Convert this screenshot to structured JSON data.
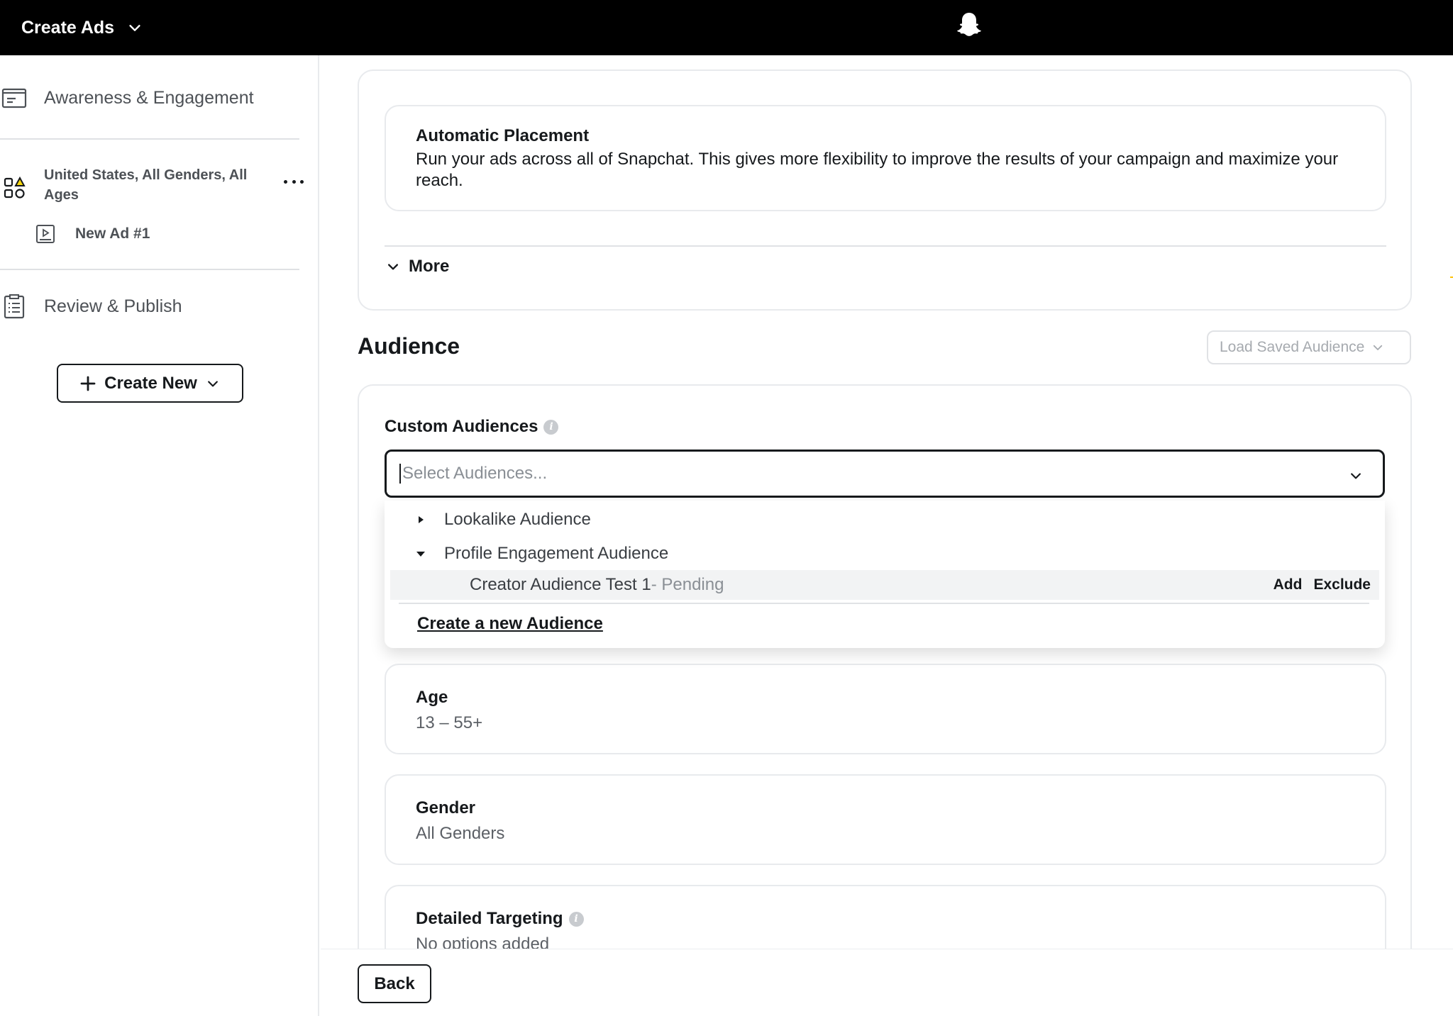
{
  "topbar": {
    "app_switch_label": "Create Ads"
  },
  "sidebar": {
    "campaign_label": "Awareness & Engagement",
    "adset_label": "United States, All Genders, All Ages",
    "ad_label": "New Ad #1",
    "review_label": "Review & Publish",
    "create_new_label": "Create New"
  },
  "placement": {
    "title": "Automatic Placement",
    "description": "Run your ads across all of Snapchat. This gives more flexibility to improve the results of your campaign and maximize your reach.",
    "more_label": "More"
  },
  "audience": {
    "heading": "Audience",
    "load_saved_label": "Load Saved Audience",
    "custom_label": "Custom Audiences",
    "select_placeholder": "Select Audiences...",
    "dropdown": {
      "group_lookalike": "Lookalike Audience",
      "group_profile": "Profile Engagement Audience",
      "item_name": "Creator Audience Test 1",
      "item_status": "- Pending",
      "add_label": "Add",
      "exclude_label": "Exclude",
      "create_link": "Create a new Audience"
    },
    "age": {
      "title": "Age",
      "value": "13 – 55+"
    },
    "gender": {
      "title": "Gender",
      "value": "All Genders"
    },
    "detailed": {
      "title": "Detailed Targeting",
      "value": "No options added"
    }
  },
  "footer": {
    "back_label": "Back"
  },
  "colors": {
    "topbar": "#000000",
    "text": "#16191c",
    "muted": "#8a8f95",
    "border": "#e8eaed"
  },
  "icons": [
    "chevron-down-icon",
    "snapchat-ghost-icon",
    "folder-icon",
    "shapes-icon",
    "ad-video-icon",
    "clipboard-icon",
    "plus-icon",
    "info-icon",
    "caret-right-icon",
    "caret-down-icon",
    "more-dots-icon"
  ]
}
